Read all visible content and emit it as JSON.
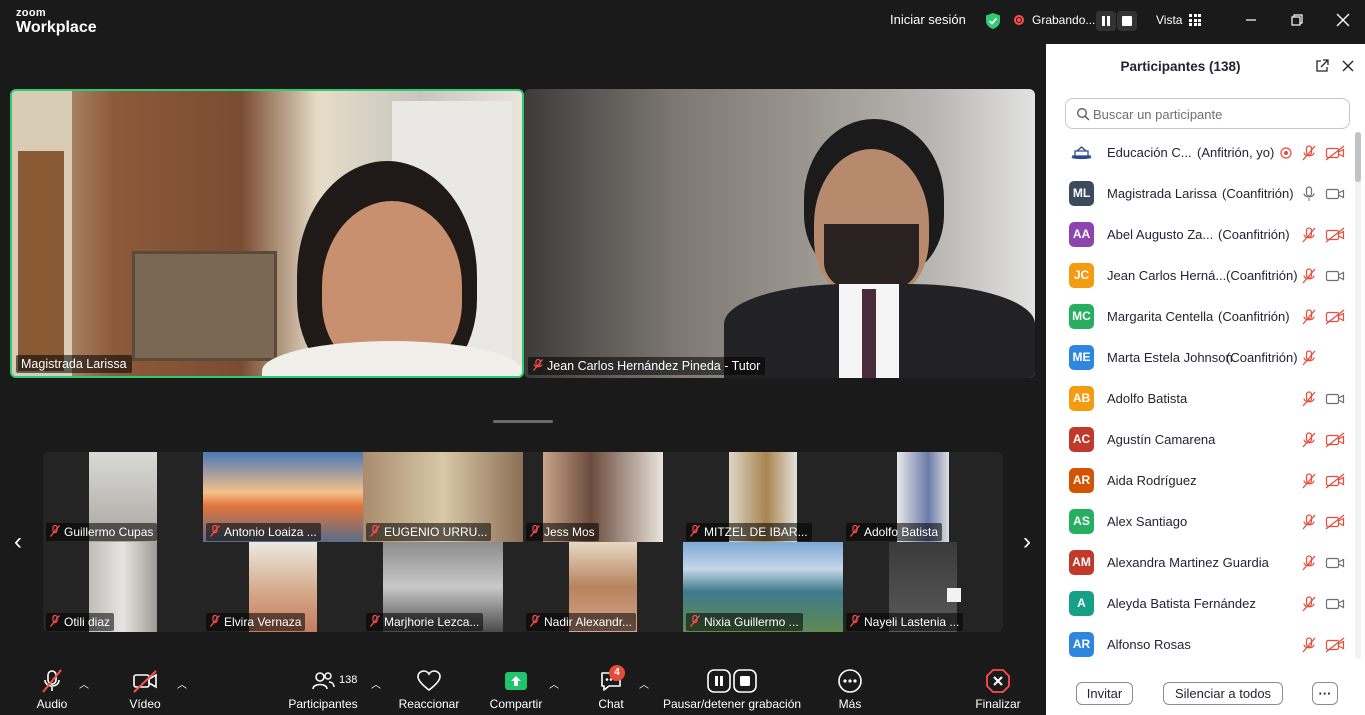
{
  "app": {
    "brand_top": "zoom",
    "brand_bottom": "Workplace"
  },
  "titlebar": {
    "sign_in": "Iniciar sesión",
    "recording_label": "Grabando...",
    "view_label": "Vista"
  },
  "main_videos": [
    {
      "name": "Magistrada Larissa",
      "mic_muted": false
    },
    {
      "name": "Jean Carlos Hernández Pineda - Tutor",
      "mic_muted": true
    }
  ],
  "gallery": [
    {
      "name": "Guillermo Cupas"
    },
    {
      "name": "Antonio Loaiza ..."
    },
    {
      "name": "EUGENIO URRU..."
    },
    {
      "name": "Jess Mos"
    },
    {
      "name": "MITZEL DE IBAR..."
    },
    {
      "name": "Adolfo Batista"
    },
    {
      "name": "Otili diaz"
    },
    {
      "name": "Elvira Vernaza"
    },
    {
      "name": "Marjhorie Lezca..."
    },
    {
      "name": "Nadir Alexandr..."
    },
    {
      "name": "Nixia Guillermo ..."
    },
    {
      "name": "Nayeli Lastenia ..."
    }
  ],
  "toolbar": {
    "audio": "Audio",
    "video": "Vídeo",
    "participants": "Participantes",
    "participants_count": "138",
    "react": "Reaccionar",
    "share": "Compartir",
    "chat": "Chat",
    "chat_badge": "4",
    "record": "Pausar/detener grabación",
    "more": "Más",
    "end": "Finalizar"
  },
  "panel": {
    "title": "Participantes (138)",
    "search_placeholder": "Buscar un participante",
    "invite": "Invitar",
    "mute_all": "Silenciar a todos",
    "more": "···",
    "participants": [
      {
        "initials": "",
        "name": "Educación C...",
        "role": "(Anfitrión, yo)",
        "color": "#ffffff",
        "mic": "muted",
        "cam": "off"
      },
      {
        "initials": "ML",
        "name": "Magistrada Larissa",
        "role": "(Coanfitrión)",
        "color": "#3b4a5c",
        "mic": "on",
        "cam": "on"
      },
      {
        "initials": "AA",
        "name": "Abel Augusto Za...",
        "role": "(Coanfitrión)",
        "color": "#8e44ad",
        "mic": "muted",
        "cam": "off"
      },
      {
        "initials": "JC",
        "name": "Jean Carlos Herná...",
        "role": "(Coanfitrión)",
        "color": "#f39c12",
        "mic": "muted",
        "cam": "on"
      },
      {
        "initials": "MC",
        "name": "Margarita Centella",
        "role": "(Coanfitrión)",
        "color": "#27ae60",
        "mic": "muted",
        "cam": "off"
      },
      {
        "initials": "ME",
        "name": "Marta Estela Johnson",
        "role": "(Coanfitrión)",
        "color": "#2e86de",
        "mic": "muted",
        "cam": "none"
      },
      {
        "initials": "AB",
        "name": "Adolfo Batista",
        "role": "",
        "color": "#f39c12",
        "mic": "muted",
        "cam": "on"
      },
      {
        "initials": "AC",
        "name": "Agustín Camarena",
        "role": "",
        "color": "#c0392b",
        "mic": "muted",
        "cam": "off"
      },
      {
        "initials": "AR",
        "name": "Aida Rodríguez",
        "role": "",
        "color": "#d35400",
        "mic": "muted",
        "cam": "off"
      },
      {
        "initials": "AS",
        "name": "Alex Santiago",
        "role": "",
        "color": "#27ae60",
        "mic": "muted",
        "cam": "off"
      },
      {
        "initials": "AM",
        "name": "Alexandra Martinez Guardia",
        "role": "",
        "color": "#c0392b",
        "mic": "muted",
        "cam": "on"
      },
      {
        "initials": "A",
        "name": "Aleyda Batista Fernández",
        "role": "",
        "color": "#16a085",
        "mic": "muted",
        "cam": "on"
      },
      {
        "initials": "AR",
        "name": "Alfonso Rosas",
        "role": "",
        "color": "#2e86de",
        "mic": "muted",
        "cam": "off"
      }
    ]
  }
}
